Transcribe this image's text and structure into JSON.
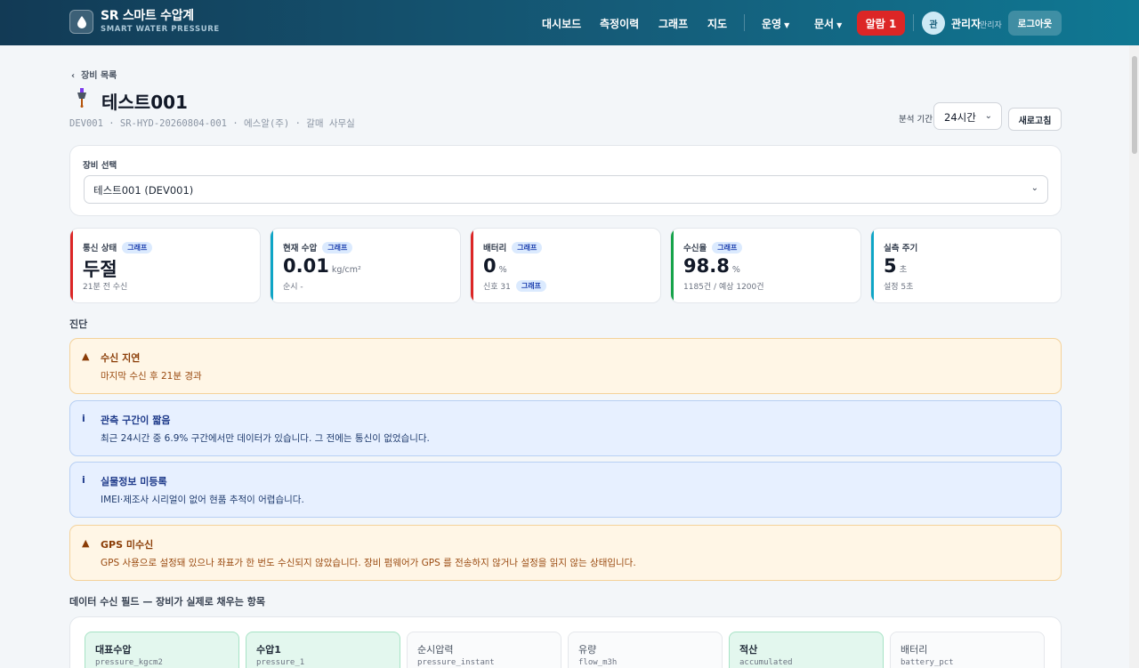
{
  "header": {
    "brand_title": "SR 스마트 수압계",
    "brand_sub": "SMART WATER PRESSURE",
    "nav": [
      "대시보드",
      "측정이력",
      "그래프",
      "지도"
    ],
    "menu_ops": "운영",
    "menu_docs": "문서",
    "alarm_label": "알람 1",
    "avatar_initial": "관",
    "user_name": "관리자",
    "user_role": "관리자",
    "logout_label": "로그아웃"
  },
  "page": {
    "back_label": "장비 목록",
    "title": "테스트001",
    "meta": "DEV001 · SR-HYD-20260804-001 · 에스알(주) · 갈매 사무실",
    "period_label": "분석 기간",
    "period_value": "24시간",
    "refresh_label": "새로고침"
  },
  "device_select": {
    "label": "장비 선택",
    "value": "테스트001 (DEV001)"
  },
  "kpis": [
    {
      "label": "통신 상태",
      "chip": "그래프",
      "value": "두절",
      "unit": "",
      "sub": "21분 전 수신",
      "sub_chip": "",
      "color": "#dc2626"
    },
    {
      "label": "현재 수압",
      "chip": "그래프",
      "value": "0.01",
      "unit": "kg/cm²",
      "sub": "순시 -",
      "sub_chip": "",
      "color": "#0ea5c6"
    },
    {
      "label": "배터리",
      "chip": "그래프",
      "value": "0",
      "unit": "%",
      "sub": "신호 31",
      "sub_chip": "그래프",
      "color": "#dc2626"
    },
    {
      "label": "수신율",
      "chip": "그래프",
      "value": "98.8",
      "unit": "%",
      "sub": "1185건 / 예상 1200건",
      "sub_chip": "",
      "color": "#16a34a"
    },
    {
      "label": "실측 주기",
      "chip": "",
      "value": "5",
      "unit": "초",
      "sub": "설정 5초",
      "sub_chip": "",
      "color": "#0ea5c6"
    }
  ],
  "diagnosis": {
    "title": "진단",
    "alerts": [
      {
        "type": "warn",
        "icon": "▲",
        "title": "수신 지연",
        "message": "마지막 수신 후 21분 경과"
      },
      {
        "type": "info",
        "icon": "i",
        "title": "관측 구간이 짧음",
        "message": "최근 24시간 중 6.9% 구간에서만 데이터가 있습니다. 그 전에는 통신이 없었습니다."
      },
      {
        "type": "info",
        "icon": "i",
        "title": "실물정보 미등록",
        "message": "IMEI·제조사 시리얼이 없어 현품 추적이 어렵습니다."
      },
      {
        "type": "warn",
        "icon": "▲",
        "title": "GPS 미수신",
        "message": "GPS 사용으로 설정돼 있으나 좌표가 한 번도 수신되지 않았습니다. 장비 펌웨어가 GPS 를 전송하지 않거나 설정을 읽지 않는 상태입니다."
      }
    ]
  },
  "fields": {
    "title": "데이터 수신 필드 — 장비가 실제로 채우는 항목",
    "items": [
      {
        "name": "대표수압",
        "key": "pressure_kgcm2",
        "active": true
      },
      {
        "name": "수압1",
        "key": "pressure_1",
        "active": true
      },
      {
        "name": "순시압력",
        "key": "pressure_instant",
        "active": false
      },
      {
        "name": "유량",
        "key": "flow_m3h",
        "active": false
      },
      {
        "name": "적산",
        "key": "accumulated",
        "active": true
      },
      {
        "name": "배터리",
        "key": "battery_pct",
        "active": false
      }
    ]
  }
}
